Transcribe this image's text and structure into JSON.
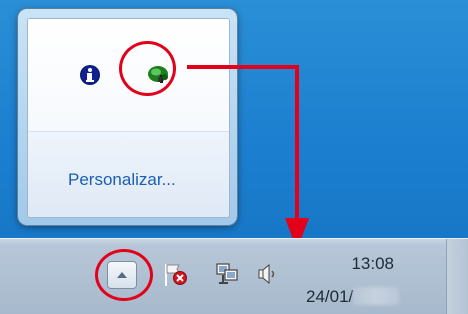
{
  "popup": {
    "link_label": "Personalizar...",
    "icons": [
      "info-icon",
      "app-icon"
    ]
  },
  "taskbar": {
    "show_hidden_icon": "chevron-up-icon",
    "tray_icons": [
      "flag-x-icon",
      "network-icon",
      "volume-icon"
    ],
    "clock_time": "13:08",
    "clock_date": "24/01/"
  },
  "colors": {
    "highlight_red": "#e3001b",
    "link_blue": "#1a5fb4"
  }
}
